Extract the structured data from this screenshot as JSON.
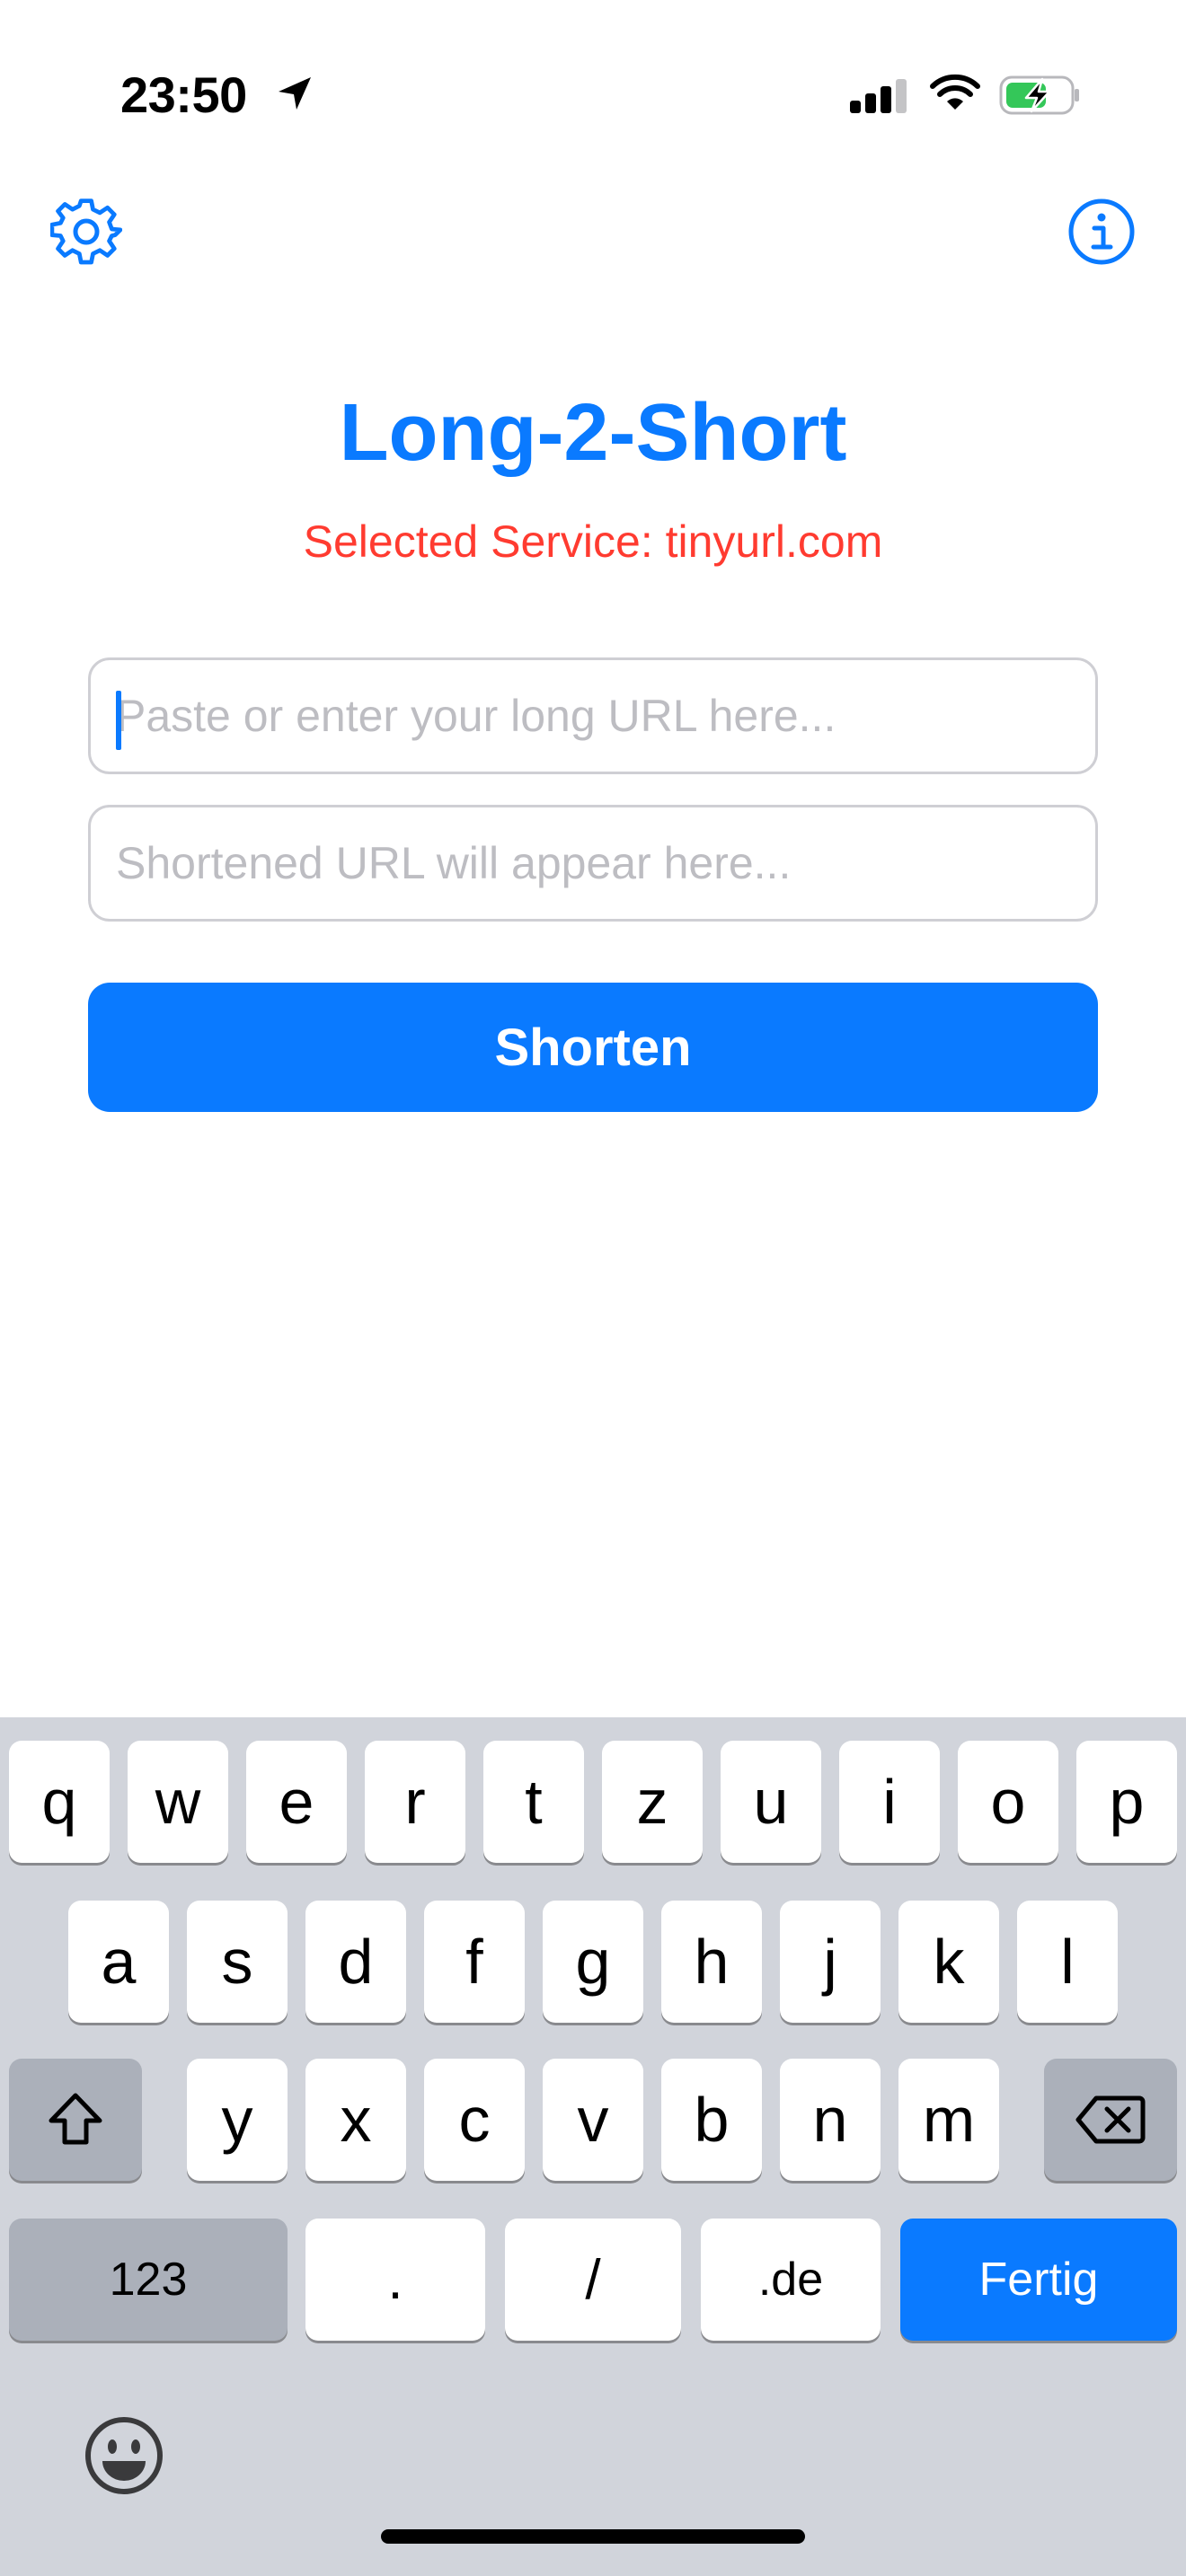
{
  "status_bar": {
    "time": "23:50",
    "icons": [
      "location-arrow-icon",
      "cellular-signal-icon",
      "wifi-icon",
      "battery-charging-icon"
    ]
  },
  "nav": {
    "left_icon": "gear-icon",
    "right_icon": "info-icon"
  },
  "app": {
    "title": "Long-2-Short",
    "selected_service": "Selected Service: tinyurl.com"
  },
  "fields": {
    "long_url_placeholder": "Paste or enter your long URL here...",
    "long_url_value": "",
    "short_url_placeholder": "Shortened URL will appear here...",
    "short_url_value": ""
  },
  "actions": {
    "shorten_label": "Shorten"
  },
  "keyboard": {
    "row1": [
      "q",
      "w",
      "e",
      "r",
      "t",
      "z",
      "u",
      "i",
      "o",
      "p"
    ],
    "row2": [
      "a",
      "s",
      "d",
      "f",
      "g",
      "h",
      "j",
      "k",
      "l"
    ],
    "row3": [
      "y",
      "x",
      "c",
      "v",
      "b",
      "n",
      "m"
    ],
    "numbers_label": "123",
    "dot_label": ".",
    "slash_label": "/",
    "tld_label": ".de",
    "done_label": "Fertig",
    "shift_icon": "shift-icon",
    "delete_icon": "delete-backspace-icon",
    "emoji_icon": "emoji-icon"
  },
  "colors": {
    "accent": "#0a7aff",
    "service_text": "#ff3b30",
    "keyboard_bg": "#d1d4db",
    "dark_key": "#abb0ba",
    "field_border": "#cfcfd4",
    "placeholder": "#bdbdc2",
    "battery_fill": "#34c759"
  }
}
